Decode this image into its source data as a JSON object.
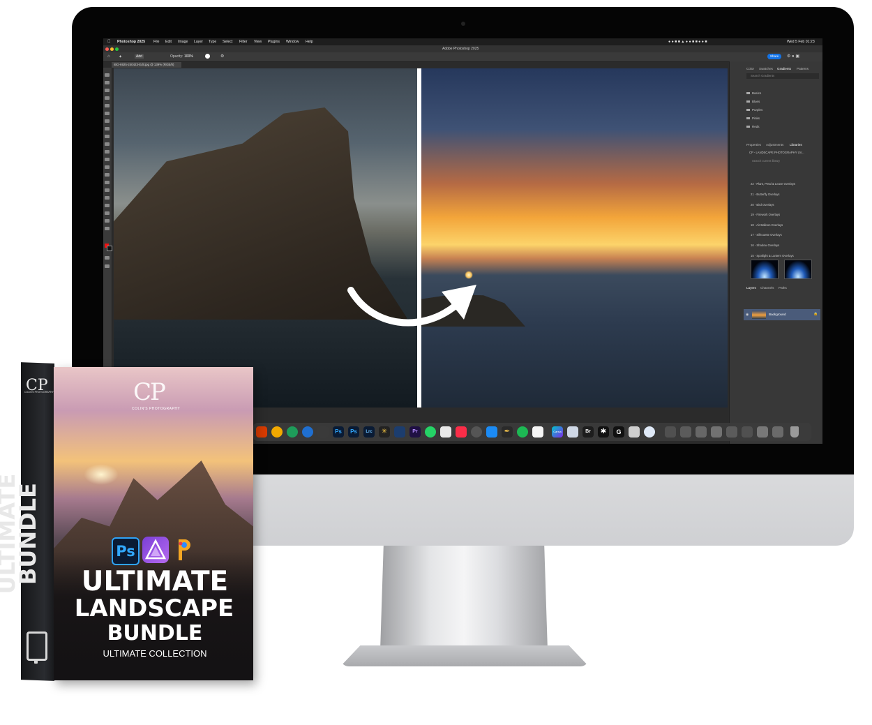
{
  "menubar": {
    "app_name": "Photoshop 2025",
    "items": [
      "File",
      "Edit",
      "Image",
      "Layer",
      "Type",
      "Select",
      "Filter",
      "View",
      "Plugins",
      "Window",
      "Help"
    ],
    "clock": "Wed 5 Feb 01:23"
  },
  "window": {
    "title": "Adobe Photoshop 2025",
    "doc_tab": "IBG-6925-240423-Edit.jpg @ 139% (RGB/8)",
    "share_label": "Share"
  },
  "options_bar": {
    "mode": "Add",
    "opacity_label": "Opacity:",
    "opacity_value": "100%"
  },
  "panels": {
    "top_tabs": [
      "Color",
      "Swatches",
      "Gradients",
      "Patterns"
    ],
    "top_active": "Gradients",
    "search_placeholder": "Search Gradients",
    "gradient_folders": [
      "Basics",
      "Blues",
      "Purples",
      "Pinks",
      "Reds"
    ],
    "mid_tabs": [
      "Properties",
      "Adjustments",
      "Libraries"
    ],
    "mid_active": "Libraries",
    "library_name": "CP - LANDSCAPE PHOTOGRAPHY UV...",
    "library_search_placeholder": "Search current library",
    "library_items": [
      "22 - Plant, Petal & Leave Overlays",
      "21 - Butterfly Overlays",
      "20 - Bird Overlays",
      "19 - Firework Overlays",
      "18 - Air Balloon Overlays",
      "17 - Silhouette Overlays",
      "16 - Shadow Overlays",
      "15 - Spotlight & Lantern Overlays"
    ],
    "layer_tabs": [
      "Layers",
      "Channels",
      "Paths"
    ],
    "layer_name": "Background"
  },
  "dock": {
    "icons": [
      "office",
      "gdata",
      "docs",
      "skype",
      "copy",
      "photoshop",
      "photoshop-beta",
      "lightroom",
      "sun",
      "affinity",
      "premiere",
      "whatsapp",
      "game",
      "music",
      "clock",
      "app-store",
      "pen",
      "spotify",
      "notes",
      "canva",
      "preview",
      "bridge",
      "asterisk",
      "g-hub",
      "calculator",
      "safari",
      "trash"
    ],
    "photoshop_label": "Ps",
    "lightroom_label": "Lrc",
    "premiere_label": "Pr",
    "bridge_label": "Br",
    "canva_label": "Canva"
  },
  "product_box": {
    "logo": "CP",
    "logo_sub": "COLIN'S PHOTOGRAPHY",
    "spine_title_line1": "ULTIMATE",
    "spine_title_line2": "BUNDLE",
    "app_ps_label": "Ps",
    "title_line1": "ULTIMATE",
    "title_line2": "LANDSCAPE",
    "title_line3": "BUNDLE",
    "subtitle": "ULTIMATE COLLECTION"
  },
  "colors": {
    "ps_blue": "#31a8ff",
    "share_button": "#1473e6",
    "selected_layer": "#4a5b7a"
  }
}
